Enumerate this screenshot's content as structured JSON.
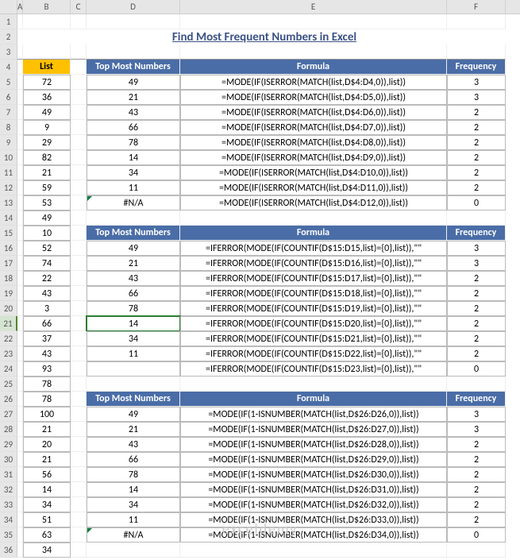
{
  "title": "Find Most Frequent Numbers in Excel",
  "watermark": "exceldemy",
  "columns": [
    "A",
    "B",
    "C",
    "D",
    "E",
    "F"
  ],
  "rowNumbers": [
    "1",
    "2",
    "3",
    "4",
    "5",
    "6",
    "7",
    "8",
    "9",
    "10",
    "11",
    "12",
    "13",
    "14",
    "15",
    "16",
    "17",
    "18",
    "19",
    "20",
    "21",
    "22",
    "23",
    "24",
    "25",
    "26",
    "27",
    "28",
    "29",
    "30",
    "31",
    "32",
    "33",
    "34",
    "35",
    "36"
  ],
  "selectedRow": 21,
  "headers": {
    "list": "List",
    "top": "Top Most Numbers",
    "formula": "Formula",
    "freq": "Frequency"
  },
  "listB": [
    "72",
    "36",
    "49",
    "9",
    "29",
    "82",
    "21",
    "59",
    "53",
    "49",
    "10",
    "52",
    "74",
    "22",
    "43",
    "3",
    "66",
    "37",
    "43",
    "93",
    "78",
    "78",
    "100",
    "21",
    "20",
    "21",
    "56",
    "14",
    "34",
    "51",
    "63",
    "34"
  ],
  "block1": [
    {
      "d": "49",
      "e": "=MODE(IF(ISERROR(MATCH(list,D$4:D4,0)),list))",
      "f": "3"
    },
    {
      "d": "21",
      "e": "=MODE(IF(ISERROR(MATCH(list,D$4:D5,0)),list))",
      "f": "3"
    },
    {
      "d": "43",
      "e": "=MODE(IF(ISERROR(MATCH(list,D$4:D6,0)),list))",
      "f": "2"
    },
    {
      "d": "66",
      "e": "=MODE(IF(ISERROR(MATCH(list,D$4:D7,0)),list))",
      "f": "2"
    },
    {
      "d": "78",
      "e": "=MODE(IF(ISERROR(MATCH(list,D$4:D8,0)),list))",
      "f": "2"
    },
    {
      "d": "14",
      "e": "=MODE(IF(ISERROR(MATCH(list,D$4:D9,0)),list))",
      "f": "2"
    },
    {
      "d": "34",
      "e": "=MODE(IF(ISERROR(MATCH(list,D$4:D10,0)),list))",
      "f": "2"
    },
    {
      "d": "11",
      "e": "=MODE(IF(ISERROR(MATCH(list,D$4:D11,0)),list))",
      "f": "2"
    },
    {
      "d": "#N/A",
      "e": "=MODE(IF(ISERROR(MATCH(list,D$4:D12,0)),list))",
      "f": "0",
      "err": true
    }
  ],
  "block2": [
    {
      "d": "49",
      "e": "=IFERROR(MODE(IF(COUNTIF(D$15:D15,list)={0},list)),\"\"",
      "f": "3"
    },
    {
      "d": "21",
      "e": "=IFERROR(MODE(IF(COUNTIF(D$15:D16,list)={0},list)),\"\"",
      "f": "3"
    },
    {
      "d": "43",
      "e": "=IFERROR(MODE(IF(COUNTIF(D$15:D17,list)={0},list)),\"\"",
      "f": "2"
    },
    {
      "d": "66",
      "e": "=IFERROR(MODE(IF(COUNTIF(D$15:D18,list)={0},list)),\"\"",
      "f": "2"
    },
    {
      "d": "78",
      "e": "=IFERROR(MODE(IF(COUNTIF(D$15:D19,list)={0},list)),\"\"",
      "f": "2"
    },
    {
      "d": "14",
      "e": "=IFERROR(MODE(IF(COUNTIF(D$15:D20,list)={0},list)),\"\"",
      "f": "2"
    },
    {
      "d": "34",
      "e": "=IFERROR(MODE(IF(COUNTIF(D$15:D21,list)={0},list)),\"\"",
      "f": "2"
    },
    {
      "d": "11",
      "e": "=IFERROR(MODE(IF(COUNTIF(D$15:D22,list)={0},list)),\"\"",
      "f": "2"
    },
    {
      "d": "",
      "e": "=IFERROR(MODE(IF(COUNTIF(D$15:D23,list)={0},list)),\"\"",
      "f": "0"
    }
  ],
  "block3": [
    {
      "d": "49",
      "e": "=MODE(IF(1-ISNUMBER(MATCH(list,D$26:D26,0)),list))",
      "f": "3"
    },
    {
      "d": "21",
      "e": "=MODE(IF(1-ISNUMBER(MATCH(list,D$26:D27,0)),list))",
      "f": "3"
    },
    {
      "d": "43",
      "e": "=MODE(IF(1-ISNUMBER(MATCH(list,D$26:D28,0)),list))",
      "f": "2"
    },
    {
      "d": "66",
      "e": "=MODE(IF(1-ISNUMBER(MATCH(list,D$26:D29,0)),list))",
      "f": "2"
    },
    {
      "d": "78",
      "e": "=MODE(IF(1-ISNUMBER(MATCH(list,D$26:D30,0)),list))",
      "f": "2"
    },
    {
      "d": "14",
      "e": "=MODE(IF(1-ISNUMBER(MATCH(list,D$26:D31,0)),list))",
      "f": "2"
    },
    {
      "d": "34",
      "e": "=MODE(IF(1-ISNUMBER(MATCH(list,D$26:D32,0)),list))",
      "f": "2"
    },
    {
      "d": "11",
      "e": "=MODE(IF(1-ISNUMBER(MATCH(list,D$26:D33,0)),list))",
      "f": "2"
    },
    {
      "d": "#N/A",
      "e": "=MODE(IF(1-ISNUMBER(MATCH(list,D$26:D34,0)),list))",
      "f": "0",
      "err": true
    }
  ],
  "colWidths": {
    "A": 7,
    "B": 60,
    "C": 20,
    "D": 118,
    "E": 336,
    "F": 74
  }
}
